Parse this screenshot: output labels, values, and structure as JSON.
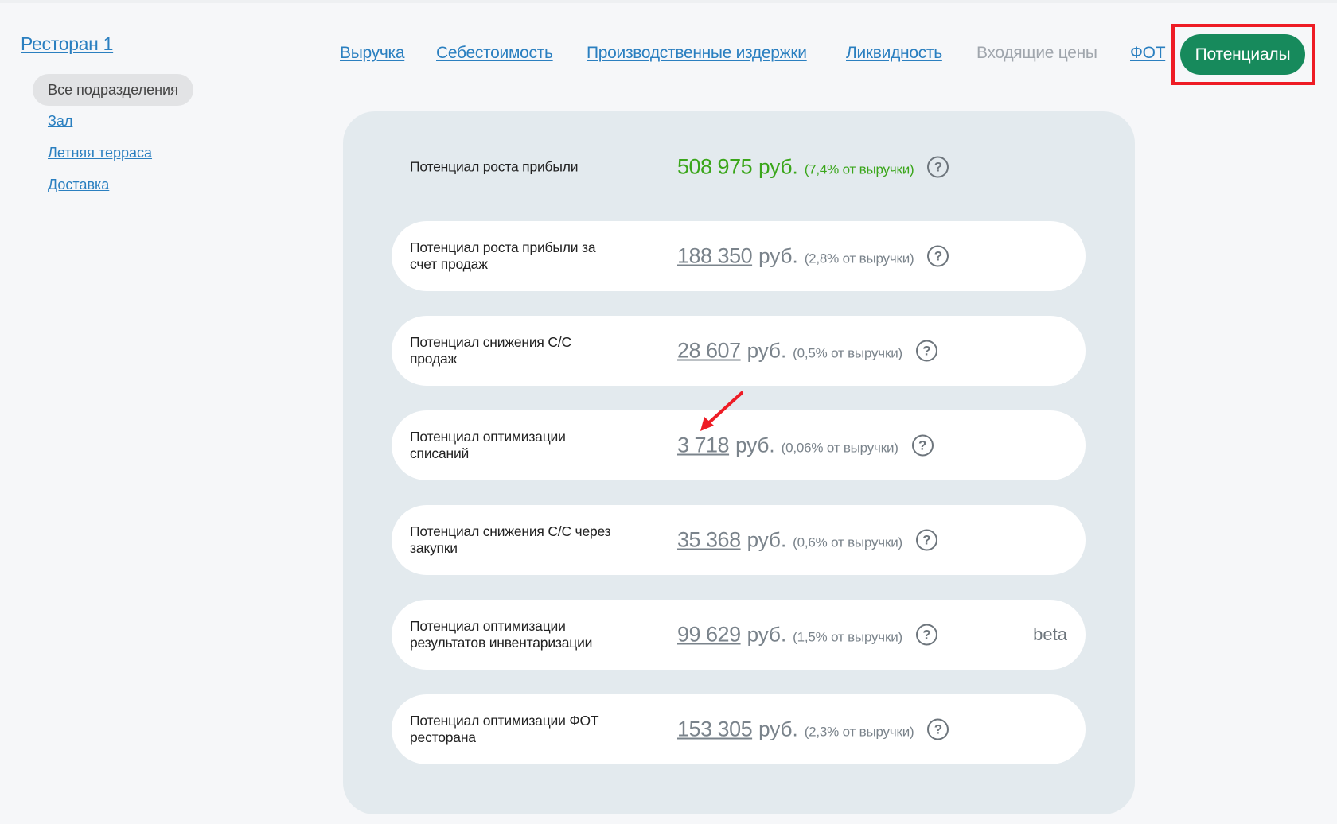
{
  "sidebar": {
    "restaurant": "Ресторан 1",
    "departments": [
      {
        "label": "Все подразделения",
        "active": true
      },
      {
        "label": "Зал"
      },
      {
        "label": "Летняя терраса"
      },
      {
        "label": "Доставка"
      }
    ]
  },
  "nav": {
    "items": [
      {
        "label": "Выручка"
      },
      {
        "label": "Себестоимость"
      },
      {
        "label": "Производственные издержки"
      },
      {
        "label": "Ликвидность"
      },
      {
        "label": "Входящие цены",
        "disabled": true
      },
      {
        "label": "ФОТ"
      },
      {
        "label": "Потенциалы",
        "active": true
      }
    ]
  },
  "potentials": {
    "rows": [
      {
        "label": "Потенциал роста прибыли",
        "amount": "508 975",
        "currency": "руб.",
        "pct": "(7,4% от выручки)",
        "help": "?"
      },
      {
        "label": "Потенциал роста прибыли за счет продаж",
        "amount": "188 350",
        "currency": "руб.",
        "pct": "(2,8% от выручки)",
        "help": "?"
      },
      {
        "label": "Потенциал снижения С/С продаж",
        "amount": "28 607",
        "currency": "руб.",
        "pct": "(0,5% от выручки)",
        "help": "?"
      },
      {
        "label": "Потенциал оптимизации списаний",
        "amount": "3 718",
        "currency": "руб.",
        "pct": "(0,06% от выручки)",
        "help": "?"
      },
      {
        "label": "Потенциал снижения С/С через закупки",
        "amount": "35 368",
        "currency": "руб.",
        "pct": "(0,6% от выручки)",
        "help": "?"
      },
      {
        "label": "Потенциал оптимизации результатов инвентаризации",
        "amount": "99 629",
        "currency": "руб.",
        "pct": "(1,5% от выручки)",
        "help": "?",
        "badge": "beta"
      },
      {
        "label": "Потенциал оптимизации ФОТ ресторана",
        "amount": "153 305",
        "currency": "руб.",
        "pct": "(2,3% от выручки)",
        "help": "?"
      }
    ]
  },
  "colors": {
    "link": "#2a7fc0",
    "accent_green": "#178a5c",
    "total_green": "#3aa61a",
    "highlight_red": "#ee1c25",
    "panel_bg": "#e3eaee"
  },
  "icons": {
    "help": "question-circle-icon",
    "annotation": "red-arrow-icon"
  }
}
